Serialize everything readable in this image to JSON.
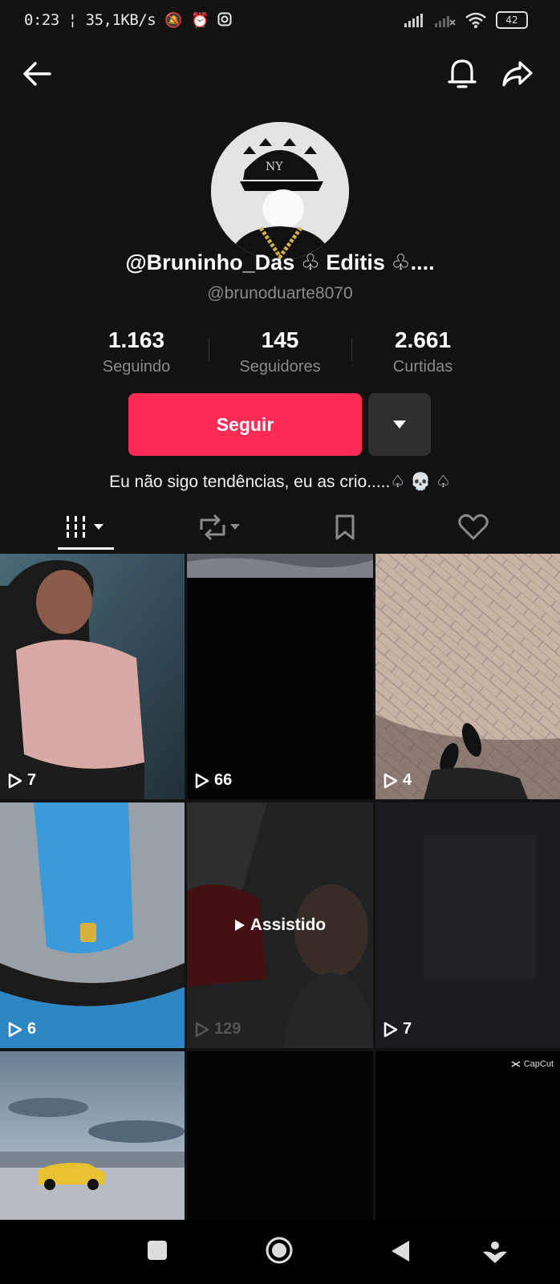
{
  "status_bar": {
    "time": "0:23",
    "speed": "35,1KB/s",
    "battery": "42"
  },
  "profile": {
    "display_name": "@Bruninho_Das ♧ Editis ♧....",
    "username": "@brunoduarte8070",
    "bio": "Eu não sigo tendências, eu as crio.....♤ 💀 ♤",
    "stats": [
      {
        "value": "1.163",
        "label": "Seguindo"
      },
      {
        "value": "145",
        "label": "Seguidores"
      },
      {
        "value": "2.661",
        "label": "Curtidas"
      }
    ],
    "follow_label": "Seguir"
  },
  "videos": [
    {
      "views": "7"
    },
    {
      "views": "66"
    },
    {
      "views": "4"
    },
    {
      "views": "6"
    },
    {
      "views": "129",
      "overlay": "Assistido"
    },
    {
      "views": "7"
    },
    {},
    {},
    {
      "watermark": "CapCut"
    }
  ],
  "colors": {
    "accent": "#fe2c55",
    "background": "#121212"
  }
}
